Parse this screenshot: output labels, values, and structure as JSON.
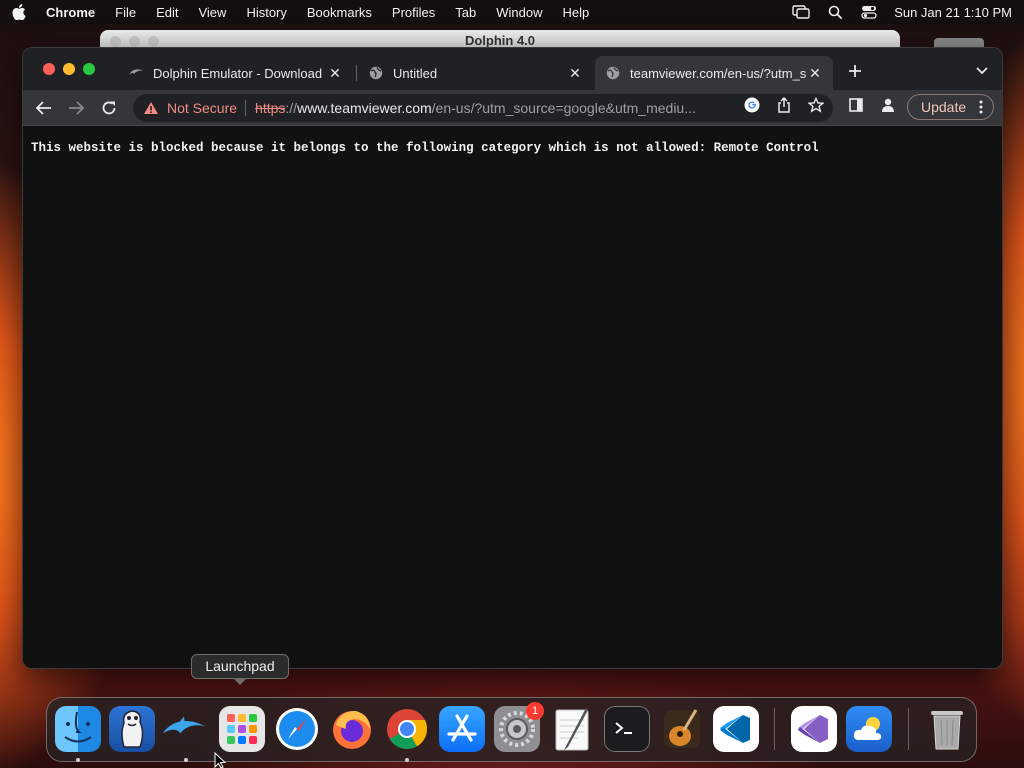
{
  "menubar": {
    "app_name": "Chrome",
    "items": [
      "File",
      "Edit",
      "View",
      "History",
      "Bookmarks",
      "Profiles",
      "Tab",
      "Window",
      "Help"
    ],
    "clock": "Sun Jan 21  1:10 PM"
  },
  "background_window": {
    "title": "Dolphin 4.0"
  },
  "browser": {
    "tabs": [
      {
        "title": "Dolphin Emulator - Download",
        "favicon": "dolphin-icon",
        "active": false
      },
      {
        "title": "Untitled",
        "favicon": "globe-icon",
        "active": false
      },
      {
        "title": "teamviewer.com/en-us/?utm_s",
        "favicon": "globe-icon",
        "active": true
      }
    ],
    "omnibox": {
      "security_label": "Not Secure",
      "scheme": "https",
      "scheme_sep": "://",
      "host": "www.teamviewer.com",
      "path": "/en-us/?utm_source=google&utm_mediu..."
    },
    "update_label": "Update",
    "page_message": "This website is blocked because it belongs to the following category which is not allowed: Remote Control"
  },
  "tooltip": {
    "text": "Launchpad"
  },
  "dock": {
    "apps": [
      "Finder",
      "SuperTux",
      "Dolphin",
      "Launchpad",
      "Safari",
      "Firefox",
      "Google Chrome",
      "App Store",
      "System Settings",
      "TextEdit",
      "Terminal",
      "GarageBand",
      "Visual Studio Code",
      "Visual Studio",
      "Weather",
      "Trash"
    ],
    "settings_badge": "1"
  },
  "colors": {
    "not_secure": "#f28b82",
    "accent_update": "#f0c6b8",
    "window_bg": "#111111",
    "toolbar_bg": "#35363a"
  }
}
